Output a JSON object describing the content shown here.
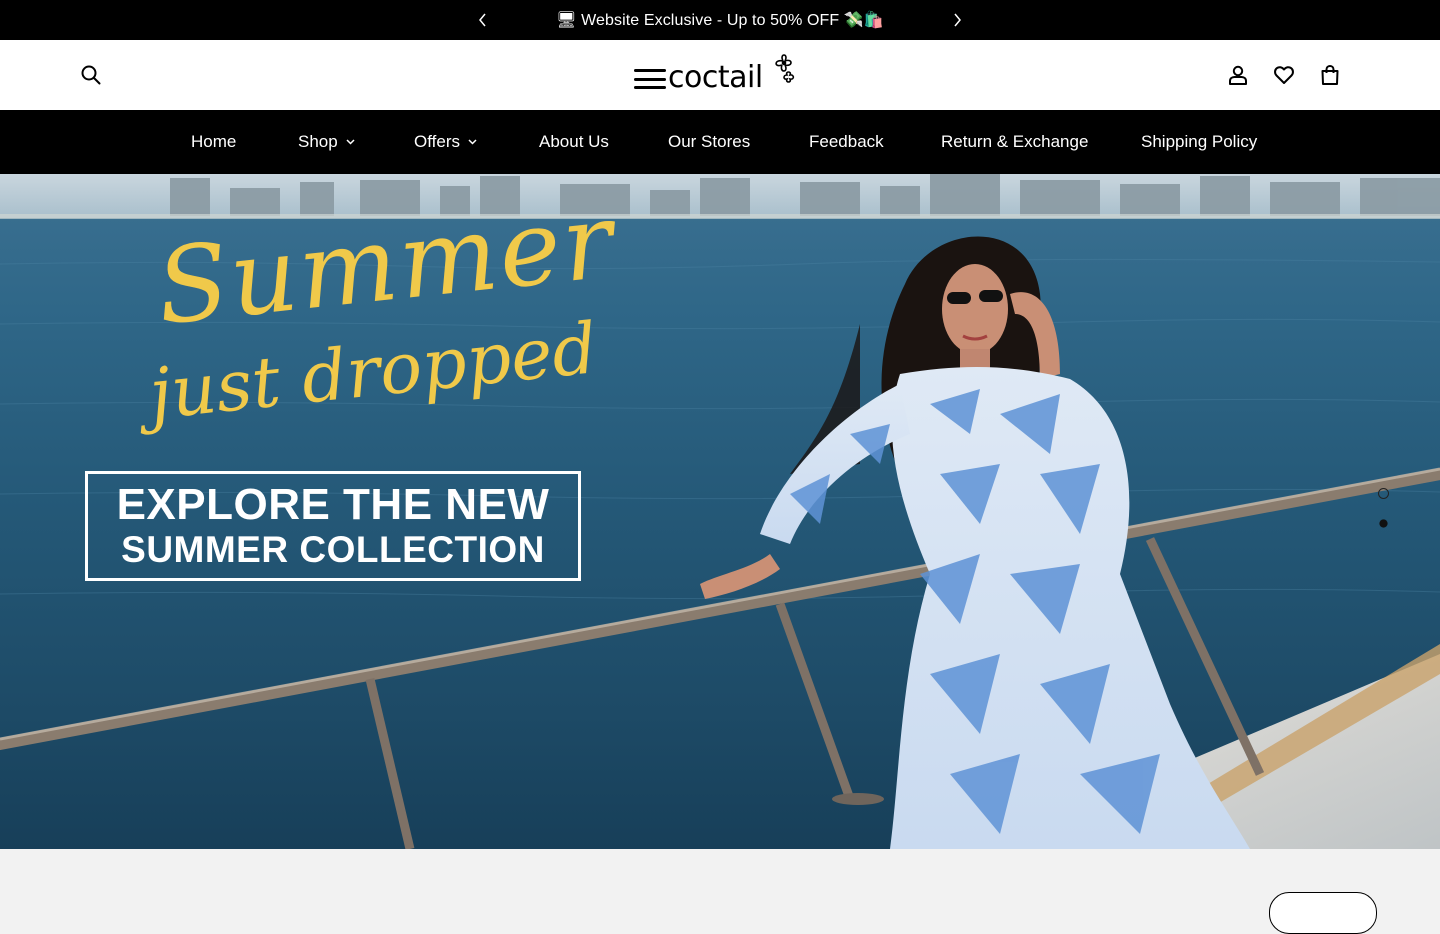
{
  "announcement": {
    "text": "🖥 Website Exclusive - Up to 50% OFF 💸🛍️"
  },
  "header": {
    "logo_text": "coctail",
    "icons": [
      "search-icon",
      "account-icon",
      "wishlist-heart-icon",
      "cart-bag-icon"
    ]
  },
  "nav": {
    "items": [
      {
        "label": "Home",
        "has_dropdown": false
      },
      {
        "label": "Shop",
        "has_dropdown": true
      },
      {
        "label": "Offers",
        "has_dropdown": true
      },
      {
        "label": "About Us",
        "has_dropdown": false
      },
      {
        "label": "Our Stores",
        "has_dropdown": false
      },
      {
        "label": "Feedback",
        "has_dropdown": false
      },
      {
        "label": "Return & Exchange",
        "has_dropdown": false
      },
      {
        "label": "Shipping Policy",
        "has_dropdown": false
      }
    ]
  },
  "hero": {
    "script_line1": "Summer",
    "script_line2": "just dropped",
    "cta_line1": "EXPLORE THE NEW",
    "cta_line2": "SUMMER COLLECTION",
    "slide_count": 2,
    "active_slide": 1
  },
  "colors": {
    "black": "#000000",
    "accent_yellow": "#f0c94a",
    "sea_blue": "#245877"
  }
}
